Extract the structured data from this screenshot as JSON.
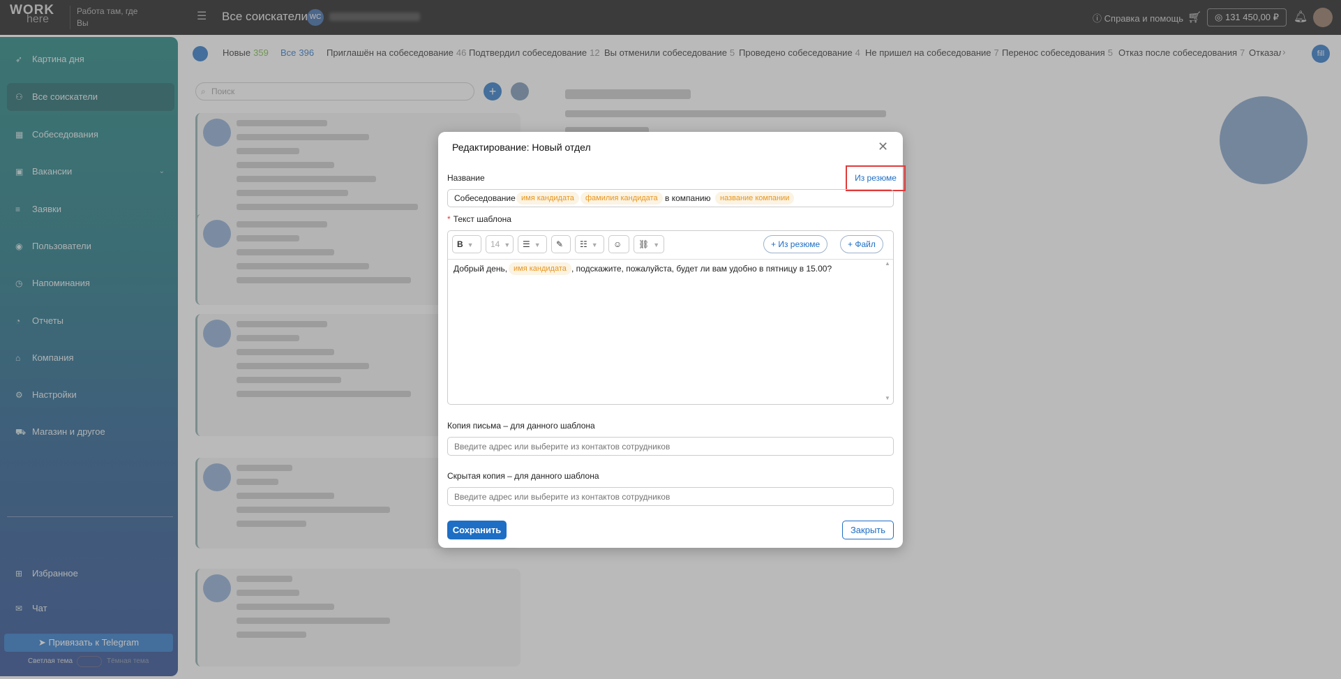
{
  "header": {
    "logo_work": "WORK",
    "logo_here": "here",
    "slogan": "Работа там, где Вы",
    "page_title": "Все соискатели",
    "user_initials": "WC",
    "help": "Справка и помощь",
    "balance": "131 450,00 ₽"
  },
  "sidebar": {
    "items": [
      {
        "label": "Картина дня",
        "icon": "rocket-icon"
      },
      {
        "label": "Все соискатели",
        "icon": "users-icon"
      },
      {
        "label": "Собеседования",
        "icon": "calendar-icon"
      },
      {
        "label": "Вакансии",
        "icon": "briefcase-icon"
      },
      {
        "label": "Заявки",
        "icon": "list-icon"
      },
      {
        "label": "Пользователи",
        "icon": "user-circle-icon"
      },
      {
        "label": "Напоминания",
        "icon": "clock-icon"
      },
      {
        "label": "Отчеты",
        "icon": "pie-chart-icon"
      },
      {
        "label": "Компания",
        "icon": "home-icon"
      },
      {
        "label": "Настройки",
        "icon": "gear-icon"
      },
      {
        "label": "Магазин и другое",
        "icon": "cart-icon"
      }
    ],
    "favorites": "Избранное",
    "chat": "Чат",
    "telegram": "Привязать к Telegram",
    "theme_light": "Светлая тема",
    "theme_dark": "Тёмная тема"
  },
  "tabs": [
    {
      "label": "Новые",
      "count": "359"
    },
    {
      "label": "Все",
      "count": "396"
    },
    {
      "label": "Приглашён на собеседование",
      "count": "46"
    },
    {
      "label": "Подтвердил собеседование",
      "count": "12"
    },
    {
      "label": "Вы отменили собеседование",
      "count": "5"
    },
    {
      "label": "Проведено собеседование",
      "count": "4"
    },
    {
      "label": "Не пришел на собеседование",
      "count": "7"
    },
    {
      "label": "Перенос собеседования",
      "count": "5"
    },
    {
      "label": "Отказ после собеседования",
      "count": "7"
    },
    {
      "label": "Отказал",
      "count": ""
    }
  ],
  "tabs_fill_label": "fill",
  "search_placeholder": "Поиск",
  "modal": {
    "title": "Редактирование: Новый отдел",
    "name_label": "Название",
    "from_resume_link": "Из резюме",
    "name_text_1": "Собеседование",
    "tag_first_name": "имя кандидата",
    "tag_last_name": "фамилия кандидата",
    "name_text_2": "в компанию",
    "tag_company": "название компании",
    "template_label": "Текст шаблона",
    "toolbar": {
      "bold": "B",
      "font_size": "14",
      "from_resume_btn": "+ Из резюме",
      "file_btn": "+ Файл"
    },
    "body_text_1": "Добрый день,",
    "body_tag": "имя кандидата",
    "body_text_2": ", подскажите, пожалуйста, будет ли вам удобно в пятницу в 15.00?",
    "copy_label": "Копия письма – для данного шаблона",
    "copy_placeholder": "Введите адрес или выберите из контактов сотрудников",
    "bcc_label": "Скрытая копия – для данного шаблона",
    "bcc_placeholder": "Введите адрес или выберите из контактов сотрудников",
    "save_button": "Сохранить",
    "close_button": "Закрыть"
  },
  "colors": {
    "accent": "#1d6ec4",
    "tag_bg": "#fbf3e3",
    "tag_text": "#e7951b",
    "highlight": "#e03a3a"
  }
}
